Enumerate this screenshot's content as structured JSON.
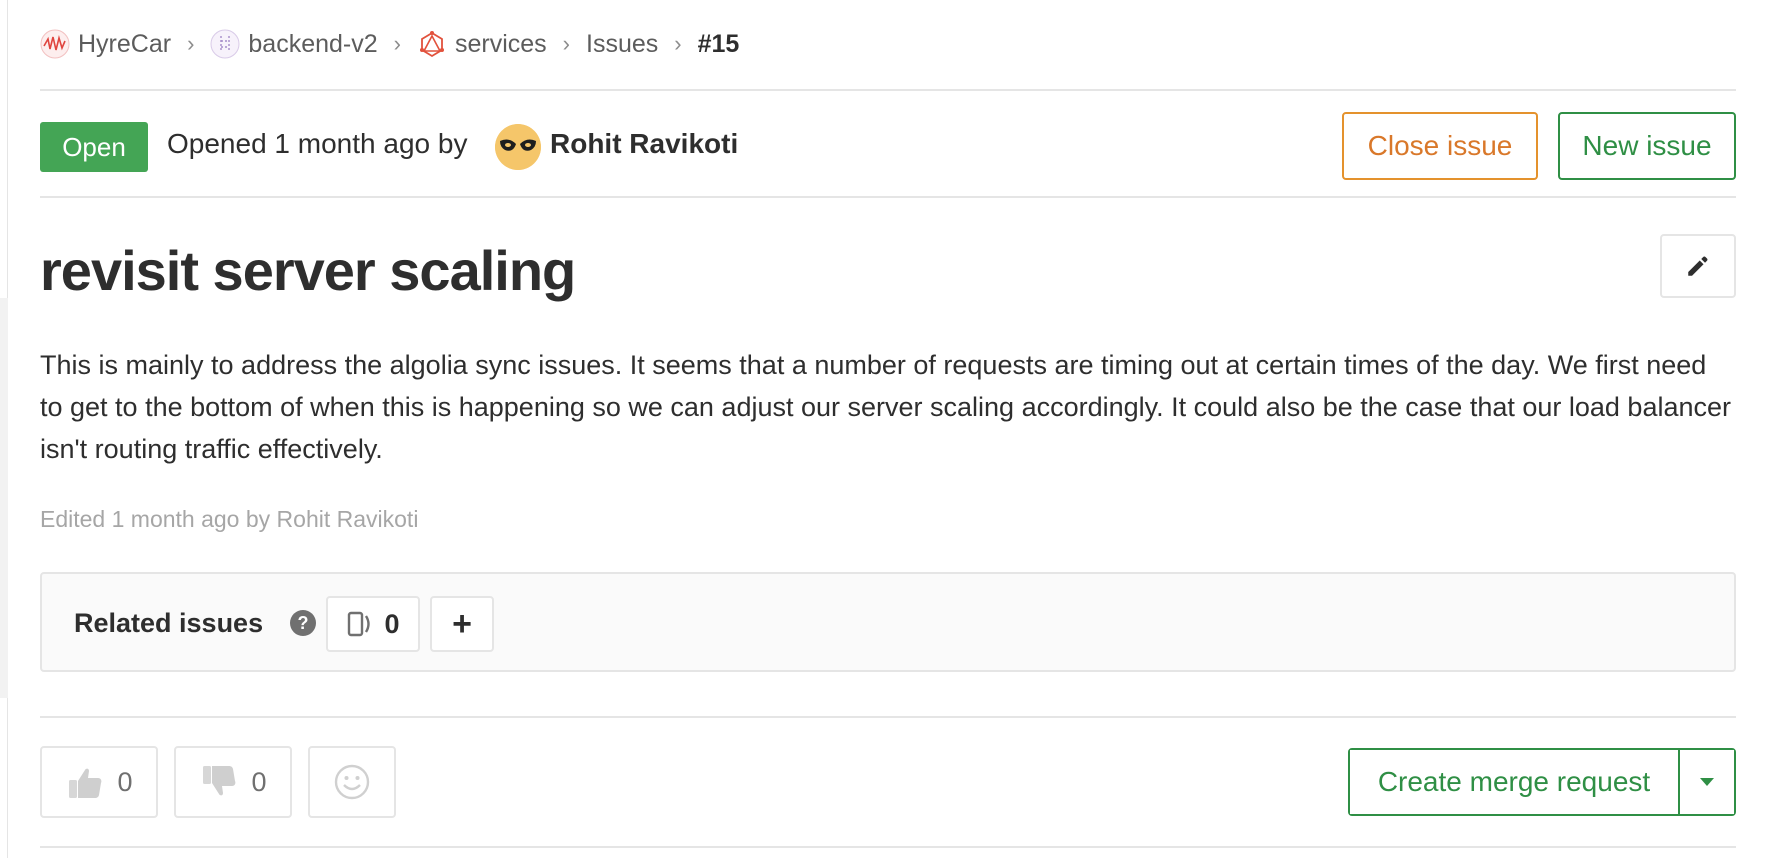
{
  "breadcrumb": {
    "items": [
      {
        "label": "HyreCar",
        "icon": "hyrecar-group-avatar"
      },
      {
        "label": "backend-v2",
        "icon": "backend-v2-group-avatar"
      },
      {
        "label": "services",
        "icon": "services-project-avatar"
      },
      {
        "label": "Issues"
      }
    ],
    "current": "#15",
    "separator": "›"
  },
  "status": {
    "badge": "Open",
    "opened_text": "Opened 1 month ago by",
    "author": "Rohit Ravikoti"
  },
  "actions": {
    "close_issue": "Close issue",
    "new_issue": "New issue"
  },
  "issue": {
    "title": "revisit server scaling",
    "description": "This is mainly to address the algolia sync issues. It seems that a number of requests are timing out at certain times of the day. We first need to get to the bottom of when this is happening so we can adjust our server scaling accordingly. It could also be the case that our load balancer isn't routing traffic effectively.",
    "edited": "Edited 1 month ago by Rohit Ravikoti"
  },
  "related": {
    "title": "Related issues",
    "help": "?",
    "count": "0",
    "add": "+"
  },
  "awards": {
    "thumbsup_count": "0",
    "thumbsdown_count": "0"
  },
  "merge": {
    "create_label": "Create merge request"
  },
  "colors": {
    "open_green": "#44a555",
    "warning_orange": "#e4922d",
    "success_green": "#2f8f45",
    "muted_text": "#a6a6a6"
  }
}
